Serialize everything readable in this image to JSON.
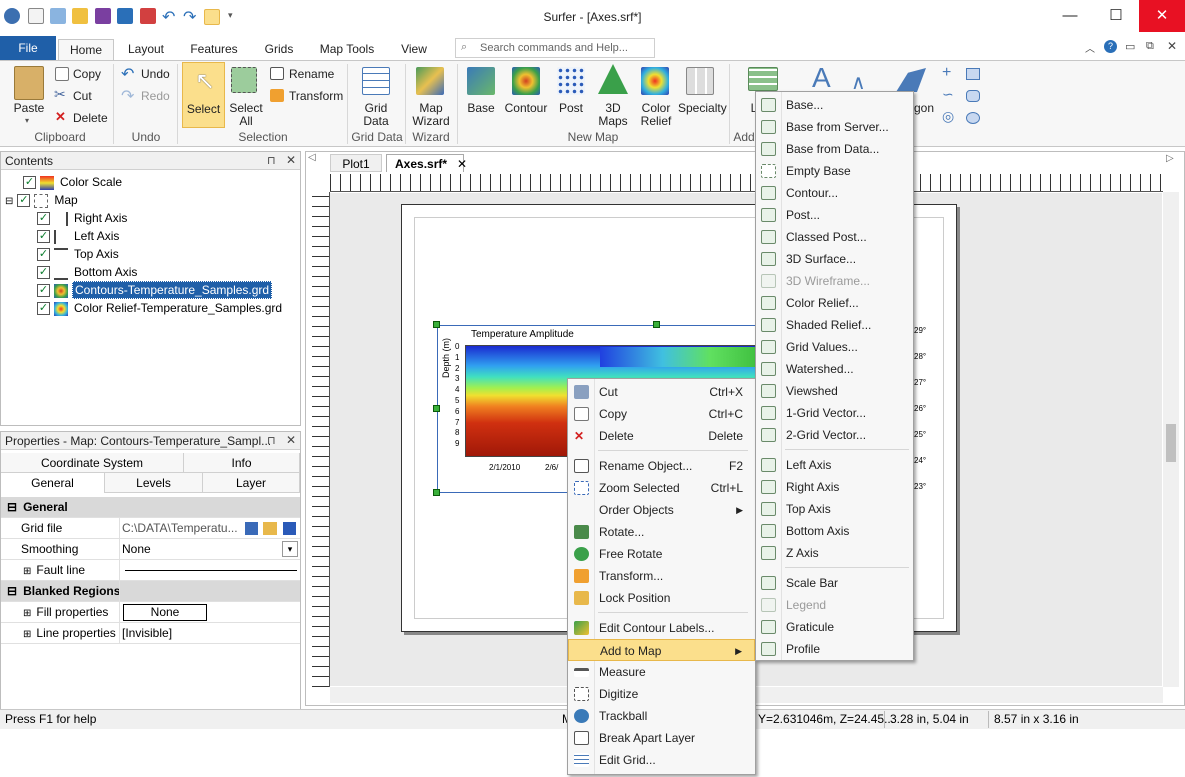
{
  "window": {
    "title": "Surfer - [Axes.srf*]"
  },
  "ribbon_tabs": [
    "File",
    "Home",
    "Layout",
    "Features",
    "Grids",
    "Map Tools",
    "View"
  ],
  "search": {
    "placeholder": "Search commands and Help..."
  },
  "clipboard": {
    "paste": "Paste",
    "copy": "Copy",
    "cut": "Cut",
    "delete": "Delete",
    "group": "Clipboard"
  },
  "undo": {
    "undo": "Undo",
    "redo": "Redo",
    "group": "Undo"
  },
  "selection": {
    "select": "Select",
    "select_all": "Select All",
    "rename": "Rename",
    "transform": "Transform",
    "group": "Selection"
  },
  "grid_data": {
    "label": "Grid Data",
    "group": "Grid Data"
  },
  "wizard": {
    "label": "Map Wizard",
    "group": "Wizard"
  },
  "new_map": {
    "base": "Base",
    "contour": "Contour",
    "post": "Post",
    "maps3d": "3D Maps",
    "color_relief": "Color Relief",
    "specialty": "Specialty",
    "group": "New Map"
  },
  "add": {
    "label": "L",
    "group": "Add"
  },
  "polygon": {
    "label": "gon"
  },
  "contents": {
    "title": "Contents",
    "items": [
      "Color Scale",
      "Map",
      "Right Axis",
      "Left Axis",
      "Top Axis",
      "Bottom Axis",
      "Contours-Temperature_Samples.grd",
      "Color Relief-Temperature_Samples.grd"
    ]
  },
  "properties": {
    "title": "Properties - Map: Contours-Temperature_Sampl...",
    "tabs_row1": [
      "Coordinate System",
      "Info"
    ],
    "tabs_row2": [
      "General",
      "Levels",
      "Layer"
    ],
    "section_general": "General",
    "grid_file_label": "Grid file",
    "grid_file_value": "C:\\DATA\\Temperatu...",
    "smoothing_label": "Smoothing",
    "smoothing_value": "None",
    "fault_line_label": "Fault line",
    "section_blanked": "Blanked Regions",
    "fill_label": "Fill properties",
    "fill_value": "None",
    "line_label": "Line properties",
    "line_value": "[Invisible]"
  },
  "doc_tabs": [
    "Plot1",
    "Axes.srf*"
  ],
  "map": {
    "title": "Temperature Amplitude",
    "ylabel": "Depth (m)",
    "yticks": [
      "0",
      "1",
      "2",
      "3",
      "4",
      "5",
      "6",
      "7",
      "8",
      "9"
    ],
    "xticks": [
      "2/1/2010",
      "2/6/"
    ],
    "scale_labels": [
      "29°",
      "28°",
      "27°",
      "26°",
      "25°",
      "24°",
      "23°"
    ]
  },
  "context_menu": [
    {
      "label": "Cut",
      "shortcut": "Ctrl+X"
    },
    {
      "label": "Copy",
      "shortcut": "Ctrl+C"
    },
    {
      "label": "Delete",
      "shortcut": "Delete"
    },
    {
      "label": "Rename Object...",
      "shortcut": "F2"
    },
    {
      "label": "Zoom Selected",
      "shortcut": "Ctrl+L"
    },
    {
      "label": "Order Objects",
      "shortcut": ""
    },
    {
      "label": "Rotate...",
      "shortcut": ""
    },
    {
      "label": "Free Rotate",
      "shortcut": ""
    },
    {
      "label": "Transform...",
      "shortcut": ""
    },
    {
      "label": "Lock Position",
      "shortcut": ""
    },
    {
      "label": "Edit Contour Labels...",
      "shortcut": ""
    },
    {
      "label": "Add to Map",
      "shortcut": ""
    },
    {
      "label": "Measure",
      "shortcut": ""
    },
    {
      "label": "Digitize",
      "shortcut": ""
    },
    {
      "label": "Trackball",
      "shortcut": ""
    },
    {
      "label": "Break Apart Layer",
      "shortcut": ""
    },
    {
      "label": "Edit Grid...",
      "shortcut": ""
    }
  ],
  "submenu": [
    "Base...",
    "Base from Server...",
    "Base from Data...",
    "Empty Base",
    "Contour...",
    "Post...",
    "Classed Post...",
    "3D Surface...",
    "3D Wireframe...",
    "Color Relief...",
    "Shaded Relief...",
    "Grid Values...",
    "Watershed...",
    "Viewshed",
    "1-Grid Vector...",
    "2-Grid Vector...",
    "Left Axis",
    "Right Axis",
    "Top Axis",
    "Bottom Axis",
    "Z Axis",
    "Scale Bar",
    "Legend",
    "Graticule",
    "Profile"
  ],
  "status": {
    "help": "Press F1 for help",
    "m": "M",
    "coords": "Y=2.631046m, Z=24.45...",
    "pos": "3.28 in, 5.04 in",
    "size": "8.57 in x 3.16 in"
  }
}
